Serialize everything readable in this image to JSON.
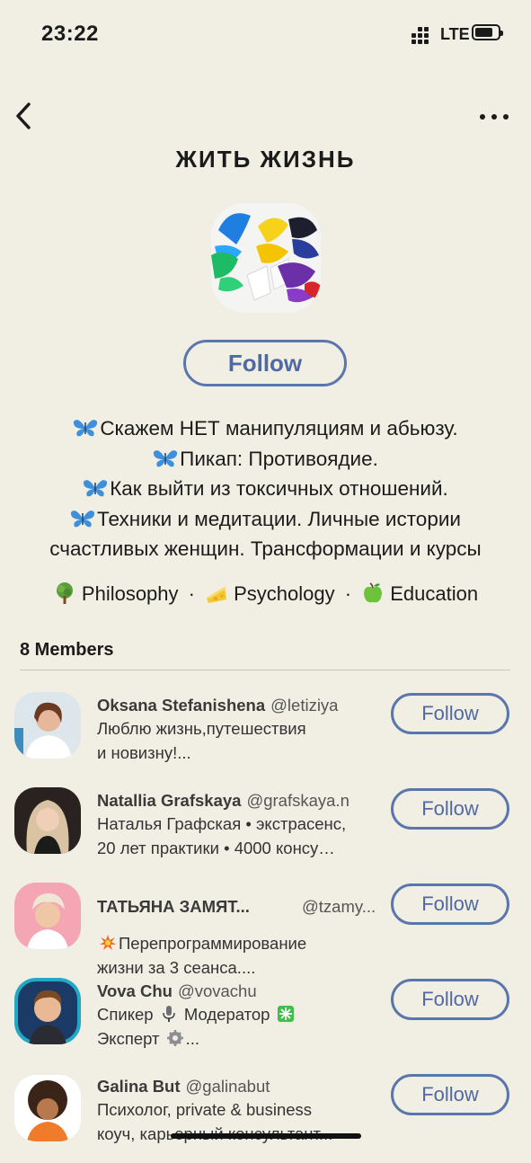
{
  "status_bar": {
    "time": "23:22",
    "network": "LTE"
  },
  "club": {
    "title": "ЖИТЬ ЖИЗНЬ",
    "follow_label": "Follow",
    "description": [
      "Скажем НЕТ манипуляциям и абьюзу.",
      "Пикап: Противоядие.",
      "Как выйти из токсичных отношений.",
      "Техники и медитации. Личные истории",
      "счастливых женщин. Трансформации и курсы"
    ],
    "topics": [
      {
        "label": "Philosophy",
        "icon": "tree-icon"
      },
      {
        "label": "Psychology",
        "icon": "cheese-icon"
      },
      {
        "label": "Education",
        "icon": "green-apple-icon"
      }
    ],
    "topic_separator": "·"
  },
  "members": {
    "count_label": "8 Members",
    "list": [
      {
        "name": "Oksana Stefanishena",
        "handle": "@letiziya",
        "bio": [
          "Люблю жизнь,путешествия",
          "и новизну!..."
        ],
        "follow_label": "Follow"
      },
      {
        "name": "Natallia Grafskaya",
        "handle": "@grafskaya.n",
        "bio": [
          "Наталья Графская • экстрасенс,",
          "20 лет практики • 4000 консу…"
        ],
        "follow_label": "Follow"
      },
      {
        "name": "ТАТЬЯНА ЗАМЯТ...",
        "handle": "@tzamy...",
        "bio": [
          "Перепрограммирование",
          "жизни за 3 сеанса...."
        ],
        "follow_label": "Follow"
      },
      {
        "name": "Vova Chu",
        "handle": "@vovachu",
        "bio_parts": [
          "Спикер",
          "Модератор",
          "Эксперт",
          "..."
        ],
        "follow_label": "Follow"
      },
      {
        "name": "Galina But",
        "handle": "@galinabut",
        "bio": [
          "Психолог, private & business",
          "коуч, карьерный консультант..."
        ],
        "follow_label": "Follow"
      }
    ]
  },
  "colors": {
    "background": "#f1efe4",
    "accent": "#5b76ad",
    "text": "#1b1b1b"
  }
}
